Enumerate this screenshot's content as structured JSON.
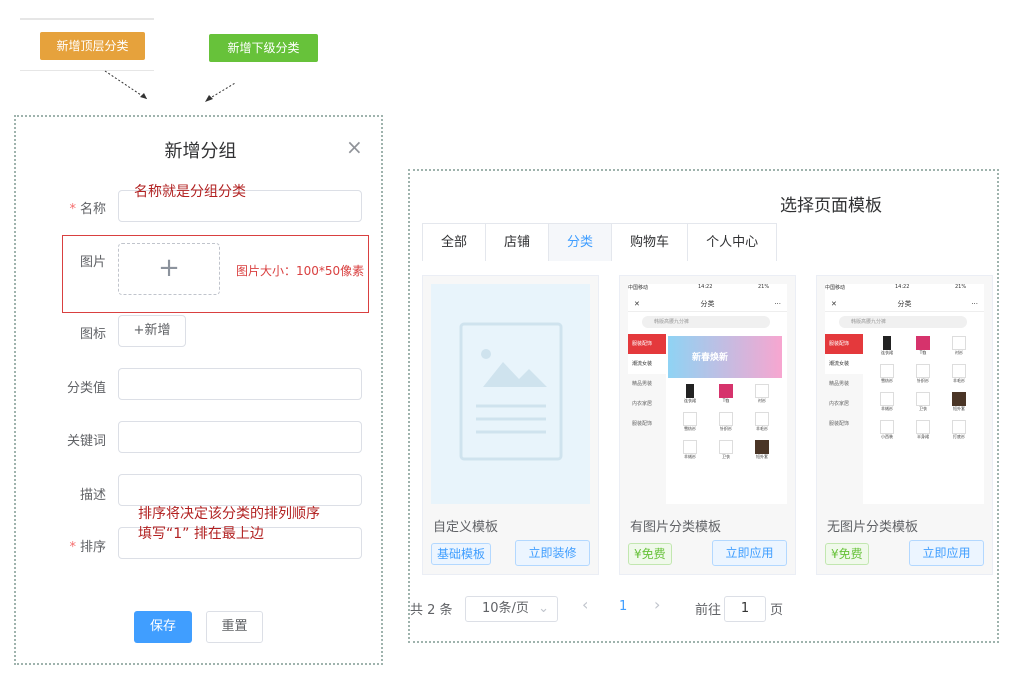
{
  "top_buttons": {
    "add_top": "新增顶层分类",
    "add_sub": "新增下级分类"
  },
  "add_group_dialog": {
    "title": "新增分组",
    "close": "×",
    "labels": {
      "name": "名称",
      "image": "图片",
      "icon": "图标",
      "value": "分类值",
      "keywords": "关键词",
      "desc": "描述",
      "sort": "排序"
    },
    "required_mark": "*",
    "upload_plus": "+",
    "add_icon_button": "+新增",
    "save": "保存",
    "reset": "重置"
  },
  "annotations": {
    "name_note": "名称就是分组分类",
    "image_size_note": "图片大小：100*50像素",
    "sort_note_line1": "排序将决定该分类的排列顺序",
    "sort_note_line2": "填写“1” 排在最上边"
  },
  "template_dialog": {
    "title": "选择页面模板",
    "tabs": [
      "全部",
      "店铺",
      "分类",
      "购物车",
      "个人中心"
    ],
    "active_tab": "分类",
    "cards": [
      {
        "name": "自定义模板",
        "tag": "基础模板",
        "button": "立即装修"
      },
      {
        "name": "有图片分类模板",
        "tag": "¥免费",
        "button": "立即应用"
      },
      {
        "name": "无图片分类模板",
        "tag": "¥免费",
        "button": "立即应用"
      }
    ],
    "phone": {
      "status_left": "中国移动",
      "time": "14:22",
      "battery": "21%",
      "page_title": "分类",
      "search_placeholder": "韩版高腰九分裤",
      "side_items": [
        "服装配饰",
        "潮流女装",
        "精品男装",
        "内衣家居",
        "服装配饰"
      ],
      "banner_text": "新春焕新",
      "items_with_image": [
        "连衣裙",
        "T恤",
        "衬衫",
        "雪纺衫",
        "针织衫",
        "羊毛衫",
        "羊绒衫",
        "卫衣",
        "短外套"
      ],
      "items_no_image": [
        "连衣裙",
        "T恤",
        "衬衫",
        "雪纺衫",
        "针织衫",
        "羊毛衫",
        "羊绒衫",
        "卫衣",
        "短外套",
        "小西装",
        "半身裙",
        "打底衫"
      ]
    },
    "pager": {
      "total": "共 2 条",
      "page_size": "10条/页",
      "prev": "‹",
      "current": "1",
      "next": "›",
      "goto_label": "前往",
      "goto_value": "1",
      "page_unit": "页"
    }
  },
  "colors": {
    "primary": "#409eff",
    "orange": "#e6a23c",
    "green": "#67c23a",
    "annotation_red": "#d94040"
  }
}
